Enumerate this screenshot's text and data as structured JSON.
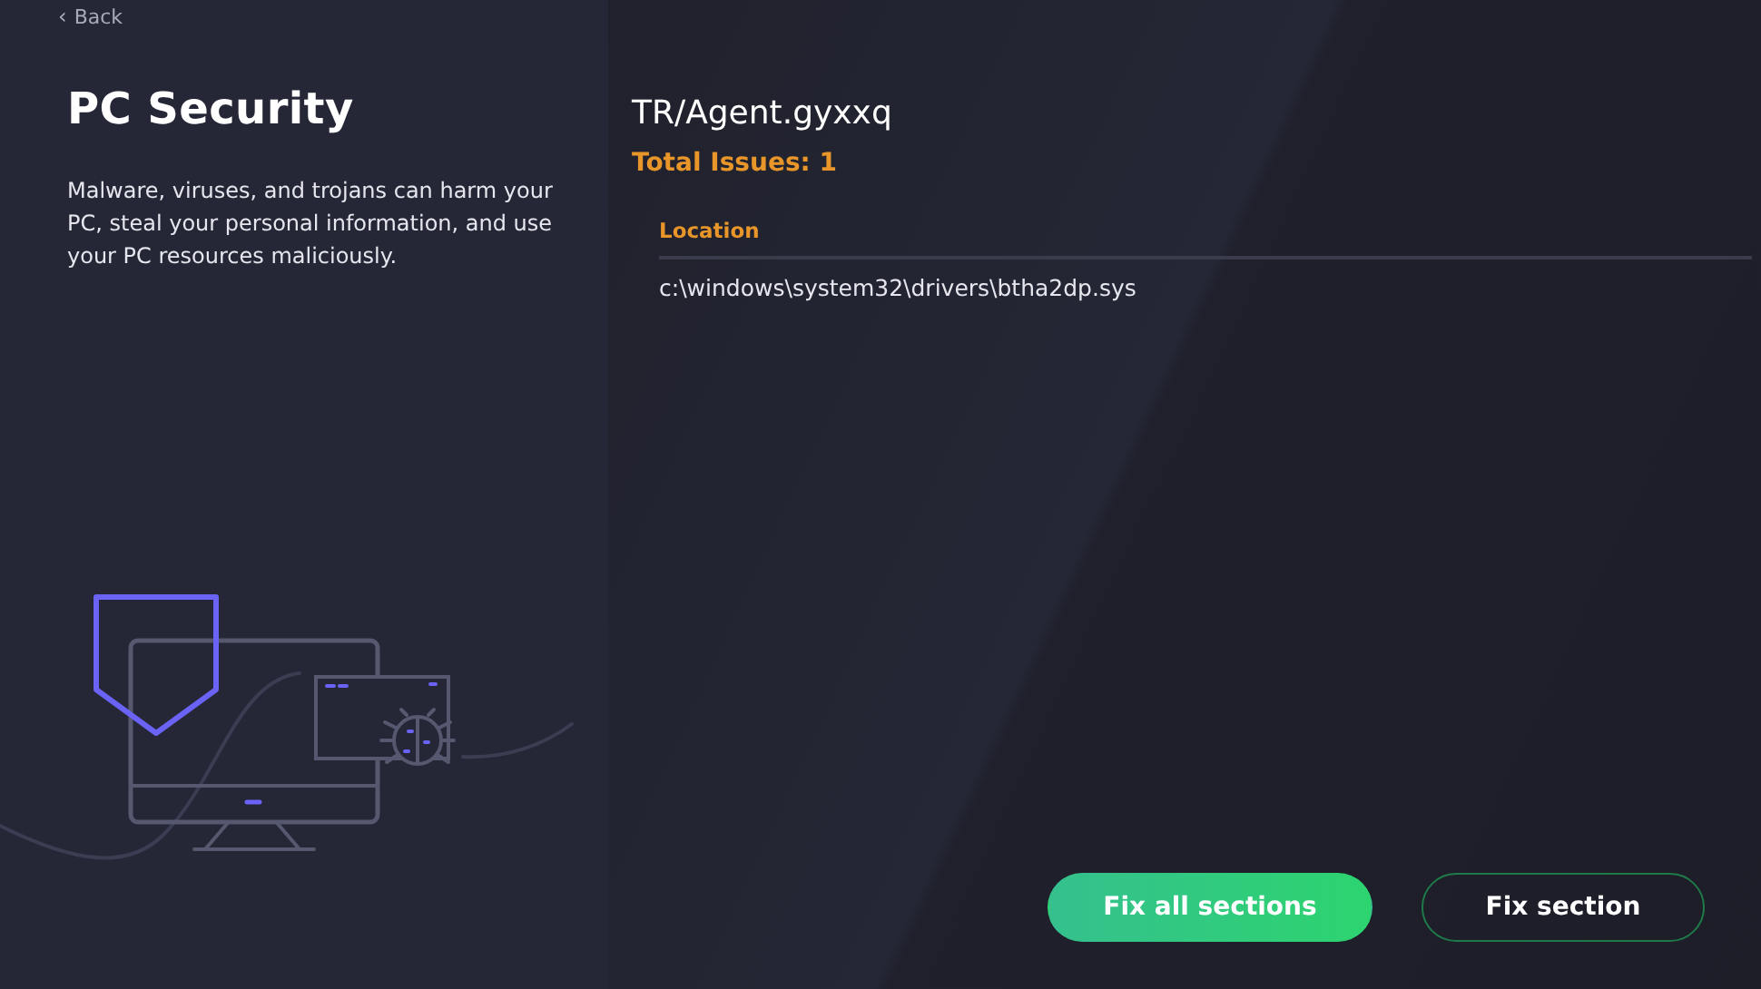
{
  "back_link": {
    "icon": "‹",
    "label": "Back"
  },
  "sidebar": {
    "title": "PC Security",
    "description": "Malware, viruses, and trojans can harm your PC, steal your personal information, and use your PC resources maliciously."
  },
  "threat": {
    "name": "TR/Agent.gyxxq",
    "total_issues": "Total Issues: 1"
  },
  "details": {
    "heading": "Location",
    "value": "c:\\windows\\system32\\drivers\\btha2dp.sys"
  },
  "buttons": [
    {
      "label": "Fix all sections",
      "kind": "primary"
    },
    {
      "label": "Fix section",
      "kind": "outline"
    }
  ]
}
